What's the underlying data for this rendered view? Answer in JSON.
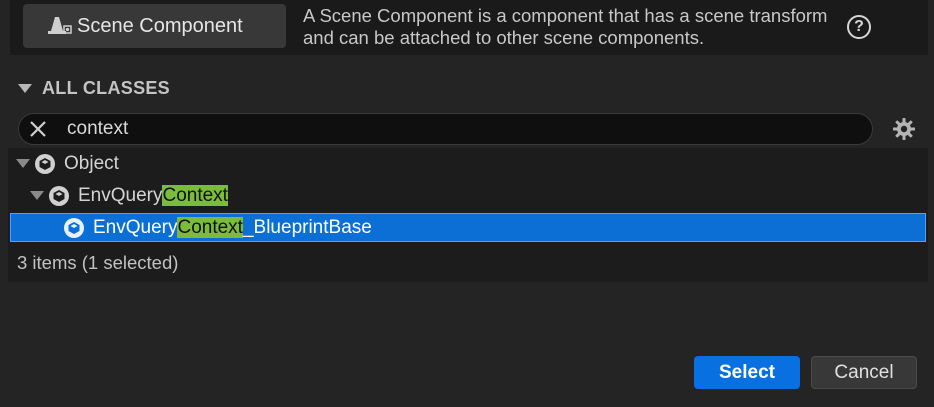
{
  "common": {
    "button_label": "Scene Component",
    "button_icon": "scene-component-icon",
    "description": "A Scene Component is a component that has a scene transform and can be attached to other scene components.",
    "help_icon": "help-icon"
  },
  "section": {
    "title": "ALL CLASSES"
  },
  "search": {
    "value": "context",
    "clear_icon": "close-icon",
    "settings_icon": "gear-icon"
  },
  "tree": {
    "items": [
      {
        "pre": "Object",
        "match": "",
        "post": "",
        "expanded": true,
        "selected": false
      },
      {
        "pre": "EnvQuery",
        "match": "Context",
        "post": "",
        "expanded": true,
        "selected": false
      },
      {
        "pre": "EnvQuery",
        "match": "Context",
        "post": "_BlueprintBase",
        "expanded": false,
        "selected": true
      }
    ],
    "highlight_color": "#7bbd3a",
    "selection_color": "#0b6fd6"
  },
  "status": {
    "text": "3 items (1 selected)"
  },
  "footer": {
    "select_label": "Select",
    "cancel_label": "Cancel"
  },
  "colors": {
    "accent": "#0870e0",
    "background": "#242424"
  }
}
